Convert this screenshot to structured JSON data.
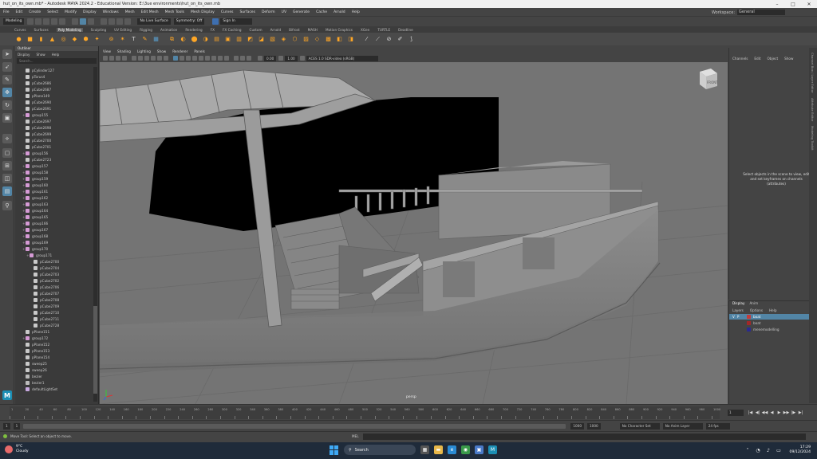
{
  "window": {
    "title": "hut_on_its_own.mb* - Autodesk MAYA 2024.2 - Educational Version: E:\\3ue environments\\hut_on_its_own.mb",
    "controls": [
      "–",
      "□",
      "✕"
    ]
  },
  "menubar": {
    "items": [
      "File",
      "Edit",
      "Create",
      "Select",
      "Modify",
      "Display",
      "Windows",
      "Mesh",
      "Edit Mesh",
      "Mesh Tools",
      "Mesh Display",
      "Curves",
      "Surfaces",
      "Deform",
      "UV",
      "Generate",
      "Cache",
      "Arnold",
      "Help"
    ],
    "workspace_label": "Workspace:",
    "workspace_value": "General"
  },
  "statusline": {
    "mode": "Modeling",
    "live_surface": "No Live Surface",
    "symmetry": "Symmetry: Off",
    "sign_in": "Sign In"
  },
  "shelf": {
    "tabs": [
      "Curves",
      "Surfaces",
      "Poly Modeling",
      "Sculpting",
      "UV Editing",
      "Rigging",
      "Animation",
      "Rendering",
      "FX",
      "FX Caching",
      "Custom",
      "Arnold",
      "Bifrost",
      "MASH",
      "Motion Graphics",
      "XGen",
      "TURTLE",
      "Deadline"
    ],
    "active_tab": "Poly Modeling"
  },
  "outliner": {
    "title": "Outliner",
    "menu": [
      "Display",
      "Show",
      "Help"
    ],
    "search_placeholder": "Search...",
    "items": [
      {
        "name": "pCylinder127",
        "indent": 1,
        "type": "mesh"
      },
      {
        "name": "pTorus4",
        "indent": 1,
        "type": "mesh"
      },
      {
        "name": "pCube2686",
        "indent": 1,
        "type": "mesh"
      },
      {
        "name": "pCube2687",
        "indent": 1,
        "type": "mesh"
      },
      {
        "name": "pPlane149",
        "indent": 1,
        "type": "mesh"
      },
      {
        "name": "pCube2690",
        "indent": 1,
        "type": "mesh"
      },
      {
        "name": "pCube2691",
        "indent": 1,
        "type": "mesh"
      },
      {
        "name": "group155",
        "indent": 1,
        "type": "group"
      },
      {
        "name": "pCube2697",
        "indent": 1,
        "type": "mesh"
      },
      {
        "name": "pCube2698",
        "indent": 1,
        "type": "mesh"
      },
      {
        "name": "pCube2699",
        "indent": 1,
        "type": "mesh"
      },
      {
        "name": "pCube2700",
        "indent": 1,
        "type": "mesh"
      },
      {
        "name": "pCube2701",
        "indent": 1,
        "type": "mesh"
      },
      {
        "name": "group156",
        "indent": 1,
        "type": "group"
      },
      {
        "name": "pCube2723",
        "indent": 1,
        "type": "mesh"
      },
      {
        "name": "group157",
        "indent": 1,
        "type": "group"
      },
      {
        "name": "group158",
        "indent": 1,
        "type": "group"
      },
      {
        "name": "group159",
        "indent": 1,
        "type": "group"
      },
      {
        "name": "group160",
        "indent": 1,
        "type": "group"
      },
      {
        "name": "group161",
        "indent": 1,
        "type": "group"
      },
      {
        "name": "group162",
        "indent": 1,
        "type": "group"
      },
      {
        "name": "group163",
        "indent": 1,
        "type": "group"
      },
      {
        "name": "group164",
        "indent": 1,
        "type": "group"
      },
      {
        "name": "group165",
        "indent": 1,
        "type": "group"
      },
      {
        "name": "group166",
        "indent": 1,
        "type": "group"
      },
      {
        "name": "group167",
        "indent": 1,
        "type": "group"
      },
      {
        "name": "group168",
        "indent": 1,
        "type": "group"
      },
      {
        "name": "group169",
        "indent": 1,
        "type": "group"
      },
      {
        "name": "group170",
        "indent": 1,
        "type": "group"
      },
      {
        "name": "group171",
        "indent": 2,
        "type": "group"
      },
      {
        "name": "pCube2700",
        "indent": 3,
        "type": "mesh"
      },
      {
        "name": "pCube2704",
        "indent": 3,
        "type": "mesh"
      },
      {
        "name": "pCube2703",
        "indent": 3,
        "type": "mesh"
      },
      {
        "name": "pCube2702",
        "indent": 3,
        "type": "mesh"
      },
      {
        "name": "pCube2706",
        "indent": 3,
        "type": "mesh"
      },
      {
        "name": "pCube2707",
        "indent": 3,
        "type": "mesh"
      },
      {
        "name": "pCube2708",
        "indent": 3,
        "type": "mesh"
      },
      {
        "name": "pCube2709",
        "indent": 3,
        "type": "mesh"
      },
      {
        "name": "pCube2710",
        "indent": 3,
        "type": "mesh"
      },
      {
        "name": "pCube2711",
        "indent": 3,
        "type": "mesh"
      },
      {
        "name": "pCube2728",
        "indent": 3,
        "type": "mesh"
      },
      {
        "name": "pPlane151",
        "indent": 1,
        "type": "mesh"
      },
      {
        "name": "group172",
        "indent": 1,
        "type": "group"
      },
      {
        "name": "pPlane152",
        "indent": 1,
        "type": "mesh"
      },
      {
        "name": "pPlane153",
        "indent": 1,
        "type": "mesh"
      },
      {
        "name": "pPlane154",
        "indent": 1,
        "type": "mesh"
      },
      {
        "name": "sweep25",
        "indent": 1,
        "type": "mesh"
      },
      {
        "name": "sweep26",
        "indent": 1,
        "type": "mesh"
      },
      {
        "name": "bezier",
        "indent": 1,
        "type": "curve"
      },
      {
        "name": "bezier1",
        "indent": 1,
        "type": "curve"
      },
      {
        "name": "defaultLightSet",
        "indent": 1,
        "type": "set"
      }
    ]
  },
  "viewport": {
    "menu": [
      "View",
      "Shading",
      "Lighting",
      "Show",
      "Renderer",
      "Panels"
    ],
    "exposure": "0.00",
    "gamma": "1.00",
    "color_space": "ACES 1.0 SDR-video (sRGB)",
    "camera_label": "persp",
    "viewcube_label": "FRONT"
  },
  "channelbox": {
    "menu": [
      "Channels",
      "Edit",
      "Object",
      "Show"
    ],
    "message": "Select objects in the scene to view, edit and set keyframes on channels (attributes)"
  },
  "sidetabs": [
    "Channel Box / Layer Editor",
    "Attribute Editor",
    "Modeling Toolkit"
  ],
  "layers": {
    "tabs": [
      "Display",
      "Anim"
    ],
    "menu": [
      "Layers",
      "Options",
      "Help"
    ],
    "rows": [
      {
        "v": "V",
        "p": "P",
        "color": "#c33c3c",
        "name": "boat",
        "selected": true
      },
      {
        "v": "",
        "p": "",
        "color": "#a12828",
        "name": "boat",
        "selected": false
      },
      {
        "v": "",
        "p": "",
        "color": "#2a2a90",
        "name": "menemodelling",
        "selected": false
      }
    ]
  },
  "timeslider": {
    "ticks": [
      "1",
      "20",
      "40",
      "60",
      "80",
      "100",
      "120",
      "140",
      "160",
      "180",
      "200",
      "220",
      "240",
      "260",
      "280",
      "300",
      "320",
      "340",
      "360",
      "380",
      "400",
      "420",
      "440",
      "460",
      "480",
      "500",
      "520",
      "540",
      "560",
      "580",
      "600",
      "620",
      "640",
      "660",
      "680",
      "700",
      "720",
      "740",
      "760",
      "780",
      "800",
      "820",
      "840",
      "860",
      "880",
      "900",
      "920",
      "940",
      "960",
      "980",
      "1000"
    ],
    "current_frame": "1",
    "playback": [
      "|◀",
      "◀|",
      "◀◀",
      "◀",
      "▶",
      "▶▶",
      "|▶",
      "▶|"
    ]
  },
  "rangeslider": {
    "start": "1",
    "start2": "1",
    "end": "1000",
    "end2": "1000",
    "character_set": "No Character Set",
    "anim_layer": "No Anim Layer",
    "fps": "24 fps"
  },
  "helpline": {
    "text": "Move Tool: Select an object to move.",
    "mel_label": "MEL"
  },
  "taskbar": {
    "temperature": "9°C",
    "weather": "Cloudy",
    "search_placeholder": "Search",
    "time": "17:29",
    "date": "09/12/2024"
  },
  "colors": {
    "selection": "#5285a6",
    "accent_orange": "#f0a030",
    "maya_blue": "#1c8fb5"
  }
}
